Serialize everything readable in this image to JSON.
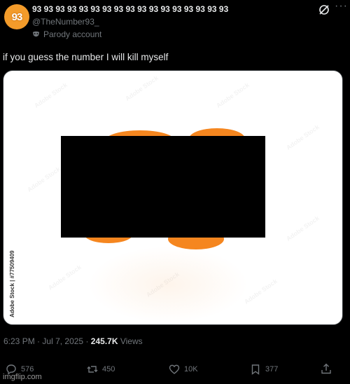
{
  "author": {
    "avatar_text": "93",
    "display_name": "93 93 93 93 93 93 93 93 93 93 93 93 93 93 93 93 93",
    "handle": "@TheNumber93_",
    "parody_label": "Parody account"
  },
  "tweet": {
    "text": "if you guess the number I will kill myself"
  },
  "media": {
    "watermark": "Adobe Stock | #77509409"
  },
  "meta": {
    "time": "6:23 PM",
    "separator": "·",
    "date": "Jul 7, 2025",
    "views_count": "245.7K",
    "views_label": "Views"
  },
  "actions": {
    "replies": "576",
    "reposts": "450",
    "likes": "10K",
    "bookmarks": "377"
  },
  "footer": {
    "watermark": "imgflip.com"
  },
  "colors": {
    "background": "#000000",
    "text_primary": "#e7e9ea",
    "text_secondary": "#71767b",
    "avatar": "#f39b2a",
    "blob": "#f5861f"
  }
}
